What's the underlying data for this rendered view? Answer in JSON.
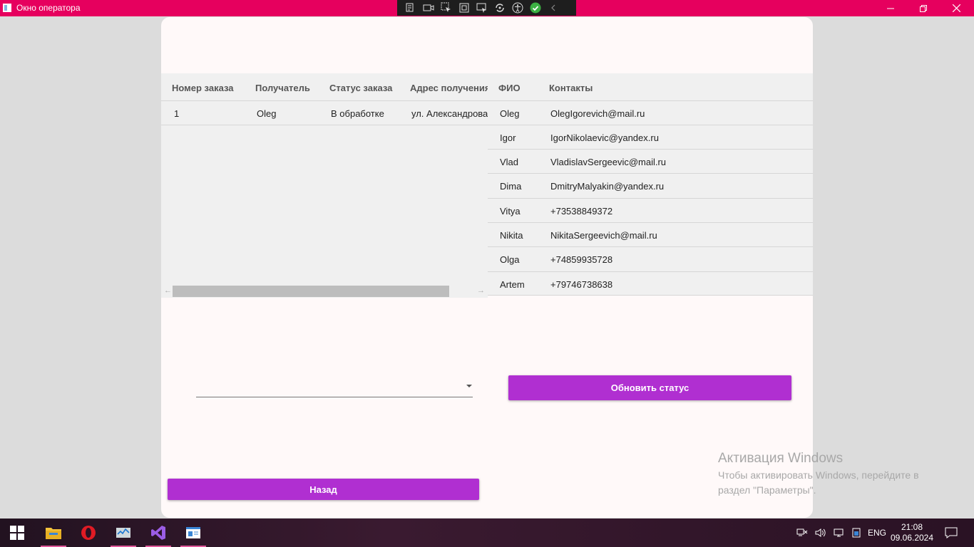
{
  "window": {
    "title": "Окно оператора"
  },
  "orders_grid": {
    "columns": [
      "Номер заказа",
      "Получатель",
      "Статус заказа",
      "Адрес получения"
    ],
    "rows": [
      {
        "number": "1",
        "recipient": "Oleg",
        "status": "В обработке",
        "address": "ул. Александрова"
      }
    ]
  },
  "contacts_grid": {
    "columns": [
      "ФИО",
      "Контакты"
    ],
    "rows": [
      {
        "name": "Oleg",
        "contact": "OlegIgorevich@mail.ru"
      },
      {
        "name": "Igor",
        "contact": "IgorNikolaevic@yandex.ru"
      },
      {
        "name": "Vlad",
        "contact": "VladislavSergeevic@mail.ru"
      },
      {
        "name": "Dima",
        "contact": "DmitryMalyakin@yandex.ru"
      },
      {
        "name": "Vitya",
        "contact": "+73538849372"
      },
      {
        "name": "Nikita",
        "contact": "NikitaSergeevich@mail.ru"
      },
      {
        "name": "Olga",
        "contact": "+74859935728"
      },
      {
        "name": "Artem",
        "contact": "+79746738638"
      }
    ]
  },
  "status_combo": {
    "value": ""
  },
  "buttons": {
    "update_status": "Обновить статус",
    "back": "Назад"
  },
  "activation": {
    "title": "Активация Windows",
    "text": "Чтобы активировать Windows, перейдите в раздел \"Параметры\"."
  },
  "tray": {
    "language": "ENG",
    "time": "21:08",
    "date": "09.06.2024"
  },
  "colors": {
    "titlebar": "#e6005e",
    "accent_button": "#b02fd1",
    "card": "#fff9f9"
  }
}
